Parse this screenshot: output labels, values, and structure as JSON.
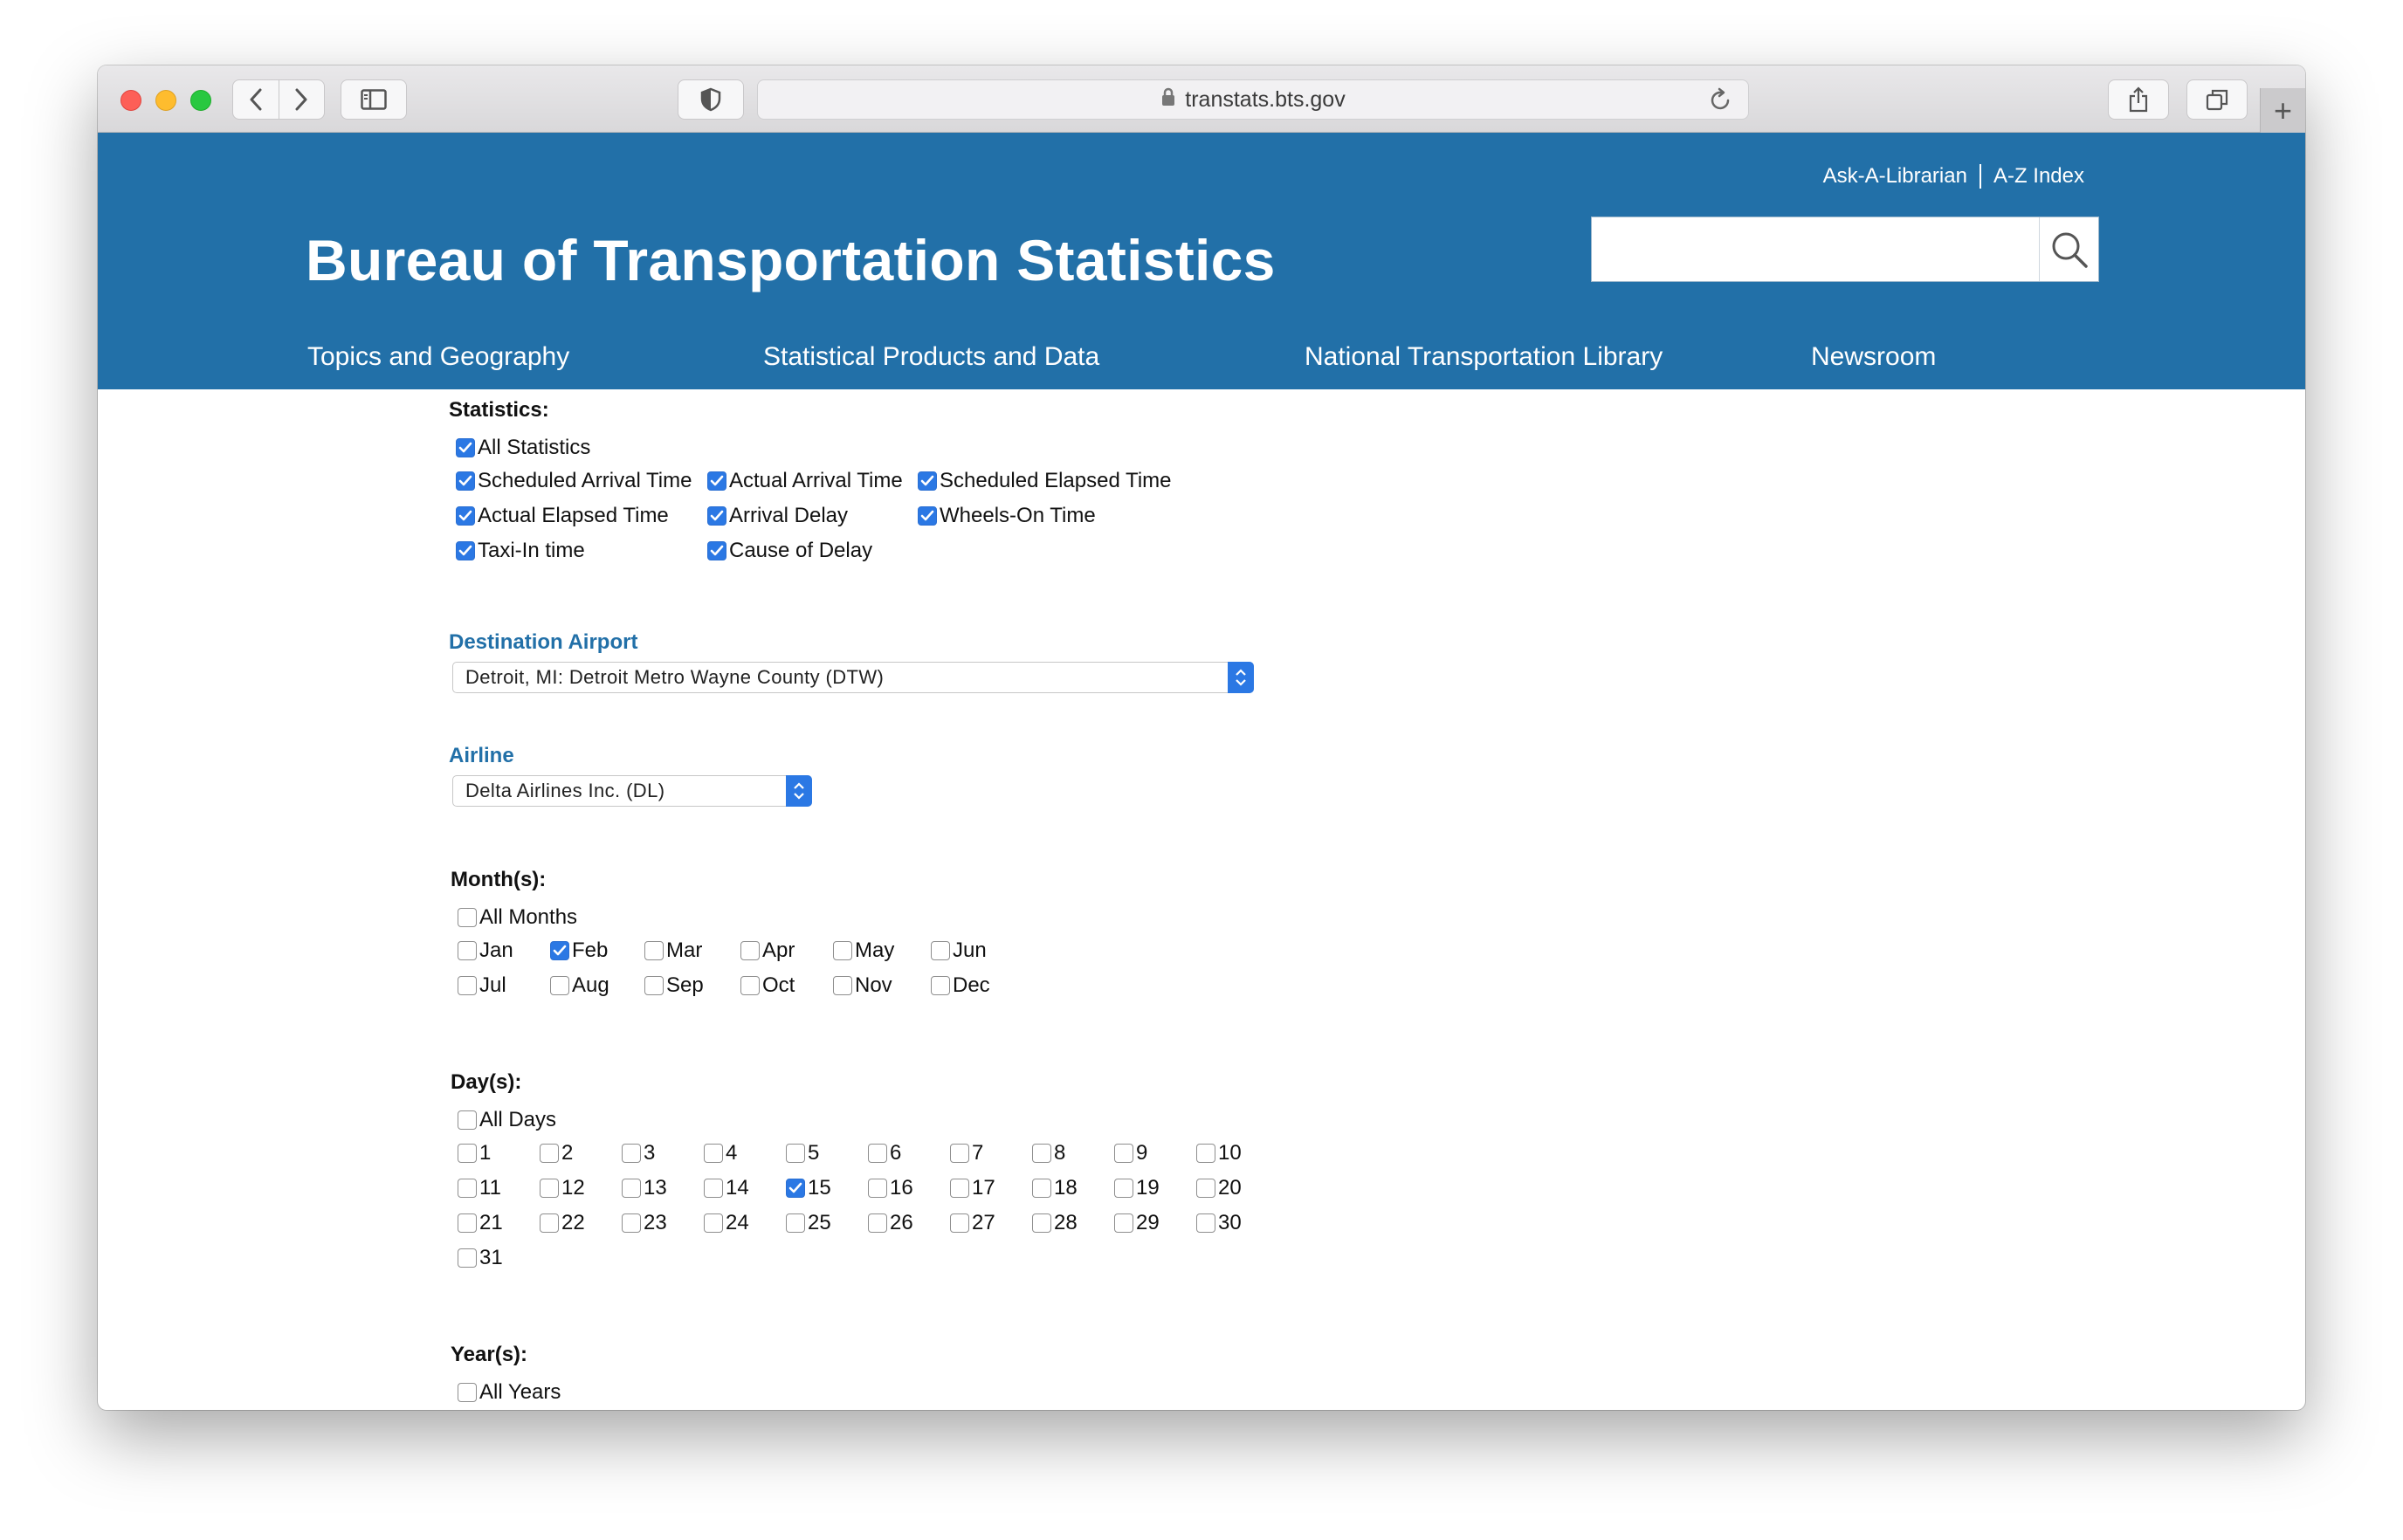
{
  "browser": {
    "url": "transtats.bts.gov"
  },
  "header": {
    "ask_librarian": "Ask-A-Librarian",
    "az_index": "A-Z Index",
    "title": "Bureau of Transportation Statistics",
    "search_value": "",
    "nav": [
      {
        "label": "Topics and Geography"
      },
      {
        "label": "Statistical Products and Data"
      },
      {
        "label": "National Transportation Library"
      },
      {
        "label": "Newsroom"
      }
    ]
  },
  "statistics": {
    "label": "Statistics:",
    "all": {
      "label": "All Statistics",
      "checked": true
    },
    "items": [
      {
        "label": "Scheduled Arrival Time",
        "checked": true
      },
      {
        "label": "Actual Arrival Time",
        "checked": true
      },
      {
        "label": "Scheduled Elapsed Time",
        "checked": true
      },
      {
        "label": "Actual Elapsed Time",
        "checked": true
      },
      {
        "label": "Arrival Delay",
        "checked": true
      },
      {
        "label": "Wheels-On Time",
        "checked": true
      },
      {
        "label": "Taxi-In time",
        "checked": true
      },
      {
        "label": "Cause of Delay",
        "checked": true
      }
    ]
  },
  "destination": {
    "label": "Destination Airport",
    "value": "Detroit, MI: Detroit Metro Wayne County (DTW)"
  },
  "airline": {
    "label": "Airline",
    "value": "Delta Airlines Inc. (DL)"
  },
  "months": {
    "label": "Month(s):",
    "all": {
      "label": "All Months",
      "checked": false
    },
    "items": [
      {
        "label": "Jan",
        "checked": false
      },
      {
        "label": "Feb",
        "checked": true
      },
      {
        "label": "Mar",
        "checked": false
      },
      {
        "label": "Apr",
        "checked": false
      },
      {
        "label": "May",
        "checked": false
      },
      {
        "label": "Jun",
        "checked": false
      },
      {
        "label": "Jul",
        "checked": false
      },
      {
        "label": "Aug",
        "checked": false
      },
      {
        "label": "Sep",
        "checked": false
      },
      {
        "label": "Oct",
        "checked": false
      },
      {
        "label": "Nov",
        "checked": false
      },
      {
        "label": "Dec",
        "checked": false
      }
    ]
  },
  "days": {
    "label": "Day(s):",
    "all": {
      "label": "All Days",
      "checked": false
    },
    "items": [
      {
        "label": "1",
        "checked": false
      },
      {
        "label": "2",
        "checked": false
      },
      {
        "label": "3",
        "checked": false
      },
      {
        "label": "4",
        "checked": false
      },
      {
        "label": "5",
        "checked": false
      },
      {
        "label": "6",
        "checked": false
      },
      {
        "label": "7",
        "checked": false
      },
      {
        "label": "8",
        "checked": false
      },
      {
        "label": "9",
        "checked": false
      },
      {
        "label": "10",
        "checked": false
      },
      {
        "label": "11",
        "checked": false
      },
      {
        "label": "12",
        "checked": false
      },
      {
        "label": "13",
        "checked": false
      },
      {
        "label": "14",
        "checked": false
      },
      {
        "label": "15",
        "checked": true
      },
      {
        "label": "16",
        "checked": false
      },
      {
        "label": "17",
        "checked": false
      },
      {
        "label": "18",
        "checked": false
      },
      {
        "label": "19",
        "checked": false
      },
      {
        "label": "20",
        "checked": false
      },
      {
        "label": "21",
        "checked": false
      },
      {
        "label": "22",
        "checked": false
      },
      {
        "label": "23",
        "checked": false
      },
      {
        "label": "24",
        "checked": false
      },
      {
        "label": "25",
        "checked": false
      },
      {
        "label": "26",
        "checked": false
      },
      {
        "label": "27",
        "checked": false
      },
      {
        "label": "28",
        "checked": false
      },
      {
        "label": "29",
        "checked": false
      },
      {
        "label": "30",
        "checked": false
      },
      {
        "label": "31",
        "checked": false
      }
    ]
  },
  "years": {
    "label": "Year(s):",
    "all": {
      "label": "All Years",
      "checked": false
    }
  },
  "colors": {
    "header_blue": "#2270a8",
    "checkbox_blue": "#2b78e4"
  }
}
